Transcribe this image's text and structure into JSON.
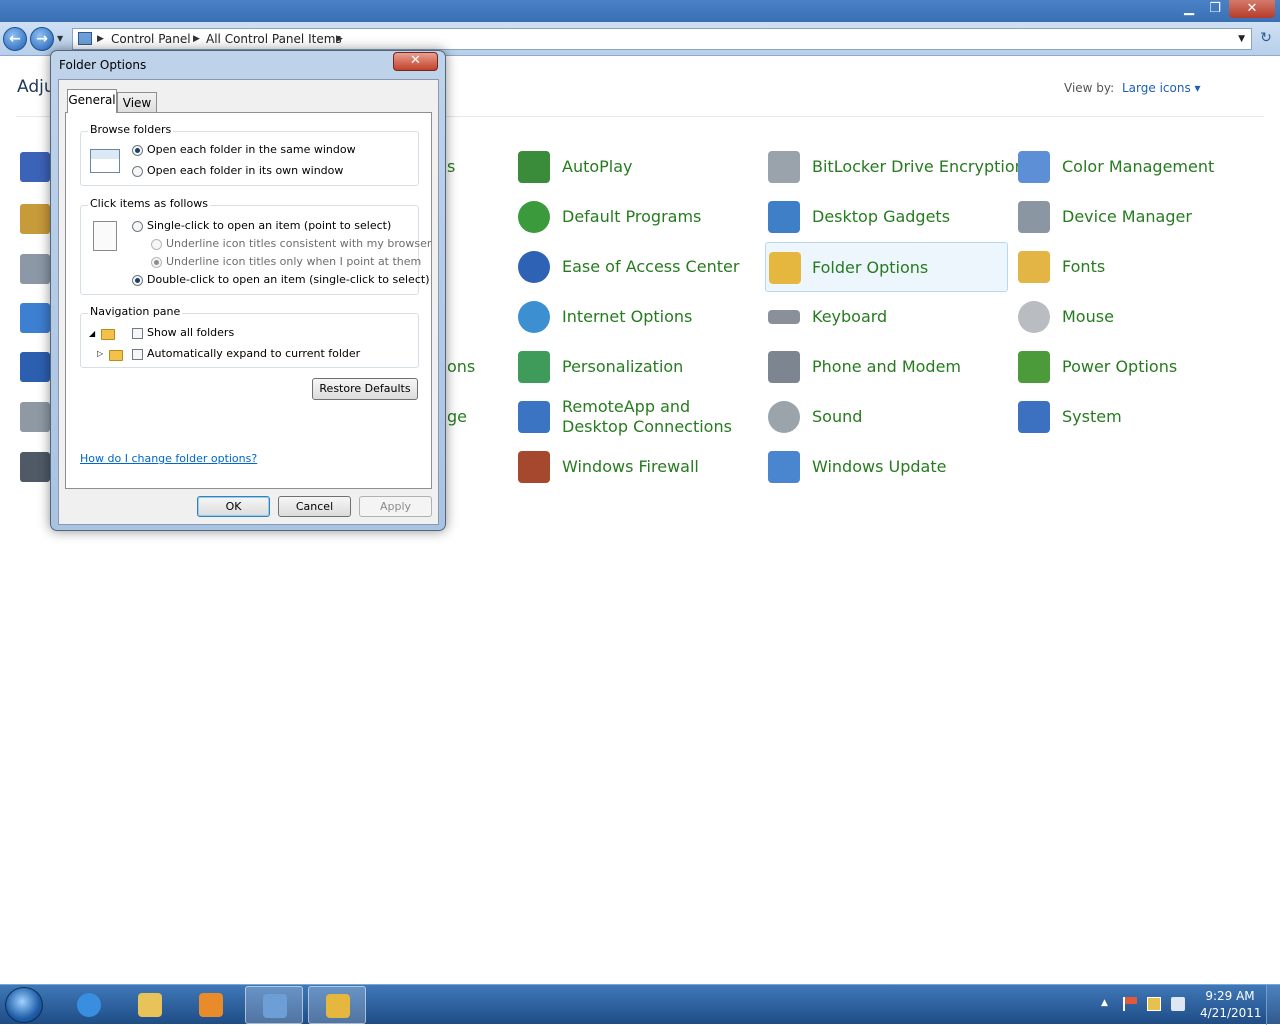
{
  "window": {
    "minimize_icon": "minimize-icon",
    "maximize_icon": "maximize-icon",
    "close_glyph": "✕",
    "minimize_glyph": "▁",
    "maximize_glyph": "❐"
  },
  "navigation": {
    "back_glyph": "←",
    "forward_glyph": "→",
    "recent_glyph": "▼",
    "breadcrumb": [
      "Control Panel",
      "All Control Panel Items"
    ],
    "crumb_separator": "▶",
    "dropdown_glyph": "▼",
    "refresh_glyph": "↻"
  },
  "content": {
    "title_partial": "Adju",
    "view_by_label": "View by:",
    "view_by_value": "Large icons ▾",
    "hidden_fragments": [
      "s",
      "ons",
      "ge"
    ],
    "items": [
      {
        "label": "AutoPlay",
        "icon": "autoplay-icon",
        "color": "#3a8c3a"
      },
      {
        "label": "BitLocker Drive Encryption",
        "icon": "bitlocker-icon",
        "color": "#9aa3ab"
      },
      {
        "label": "Color Management",
        "icon": "color-management-icon",
        "color": "#5c8fd6"
      },
      {
        "label": "Default Programs",
        "icon": "default-programs-icon",
        "color": "#3b9a3b"
      },
      {
        "label": "Desktop Gadgets",
        "icon": "desktop-gadgets-icon",
        "color": "#3f7fc8"
      },
      {
        "label": "Device Manager",
        "icon": "device-manager-icon",
        "color": "#8b96a3"
      },
      {
        "label": "Ease of Access Center",
        "icon": "ease-of-access-icon",
        "color": "#2e62b5"
      },
      {
        "label": "Folder Options",
        "icon": "folder-options-icon",
        "color": "#e6b73e"
      },
      {
        "label": "Fonts",
        "icon": "fonts-icon",
        "color": "#e3b545"
      },
      {
        "label": "Internet Options",
        "icon": "internet-options-icon",
        "color": "#3c8fd0"
      },
      {
        "label": "Keyboard",
        "icon": "keyboard-icon",
        "color": "#8a9099"
      },
      {
        "label": "Mouse",
        "icon": "mouse-icon",
        "color": "#b9bcc0"
      },
      {
        "label": "Personalization",
        "icon": "personalization-icon",
        "color": "#3f9b5a"
      },
      {
        "label": "Phone and Modem",
        "icon": "phone-modem-icon",
        "color": "#7d8690"
      },
      {
        "label": "Power Options",
        "icon": "power-options-icon",
        "color": "#4c9b3a"
      },
      {
        "label": "RemoteApp and Desktop Connections",
        "icon": "remoteapp-icon",
        "color": "#3a74c2"
      },
      {
        "label": "Sound",
        "icon": "sound-icon",
        "color": "#9ba3ab"
      },
      {
        "label": "System",
        "icon": "system-icon",
        "color": "#3c70c0"
      },
      {
        "label": "Windows Firewall",
        "icon": "windows-firewall-icon",
        "color": "#a5482d"
      },
      {
        "label": "Windows Update",
        "icon": "windows-update-icon",
        "color": "#4a86d0"
      }
    ]
  },
  "dialog": {
    "title": "Folder Options",
    "close_glyph": "✕",
    "tabs": [
      "General",
      "View"
    ],
    "browse_folders": {
      "legend": "Browse folders",
      "options": [
        "Open each folder in the same window",
        "Open each folder in its own window"
      ]
    },
    "click_items": {
      "legend": "Click items as follows",
      "single_click": "Single-click to open an item (point to select)",
      "underline_browser": "Underline icon titles consistent with my browser",
      "underline_point": "Underline icon titles only when I point at them",
      "double_click": "Double-click to open an item (single-click to select)"
    },
    "navigation_pane": {
      "legend": "Navigation pane",
      "show_all_folders": "Show all folders",
      "auto_expand": "Automatically expand to current folder",
      "tree_expanded_glyph": "◢",
      "tree_collapsed_glyph": "▷"
    },
    "restore_defaults": "Restore Defaults",
    "help_link": "How do I change folder options?",
    "ok": "OK",
    "cancel": "Cancel",
    "apply": "Apply"
  },
  "taskbar": {
    "time": "9:29 AM",
    "date": "4/21/2011",
    "tray_arrow": "▲"
  }
}
